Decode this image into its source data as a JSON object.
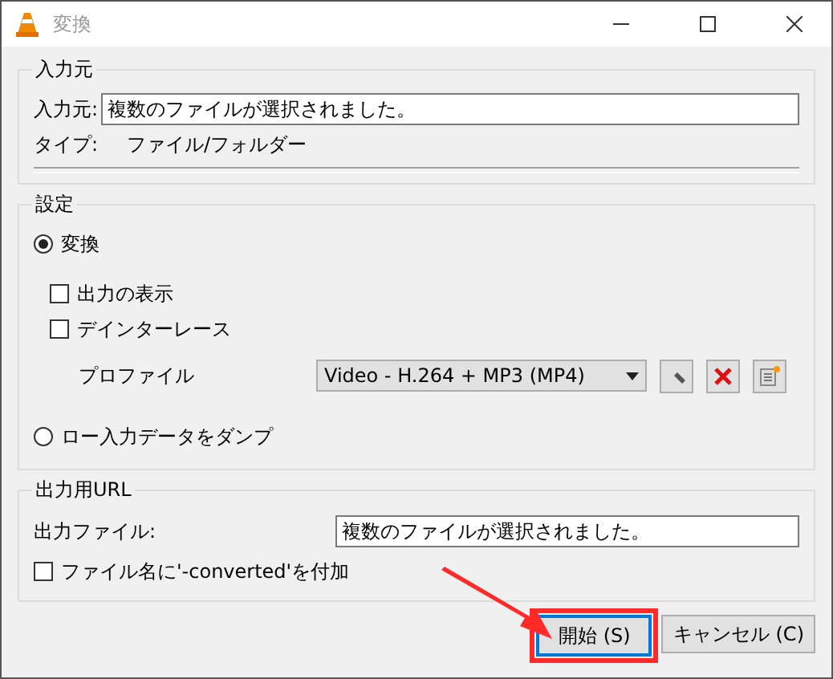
{
  "window": {
    "title": "変換"
  },
  "source": {
    "legend": "入力元",
    "label": "入力元:",
    "value": "複数のファイルが選択されました。",
    "type_label": "タイプ:",
    "type_value": "ファイル/フォルダー"
  },
  "settings": {
    "legend": "設定",
    "modes": [
      {
        "label": "変換",
        "selected": true
      },
      {
        "label": "ロー入力データをダンプ",
        "selected": false
      }
    ],
    "options": [
      {
        "label": "出力の表示",
        "checked": false
      },
      {
        "label": "デインターレース",
        "checked": false
      }
    ],
    "profile_label": "プロファイル",
    "profile_value": "Video - H.264 + MP3 (MP4)"
  },
  "output": {
    "legend": "出力用URL",
    "label": "出力ファイル:",
    "value": "複数のファイルが選択されました。",
    "append": {
      "label": "ファイル名に'-converted'を付加",
      "checked": false
    }
  },
  "buttons": [
    {
      "label": "開始 (S)",
      "focused": true,
      "highlighted": true
    },
    {
      "label": "キャンセル (C)",
      "focused": false,
      "highlighted": false
    }
  ]
}
